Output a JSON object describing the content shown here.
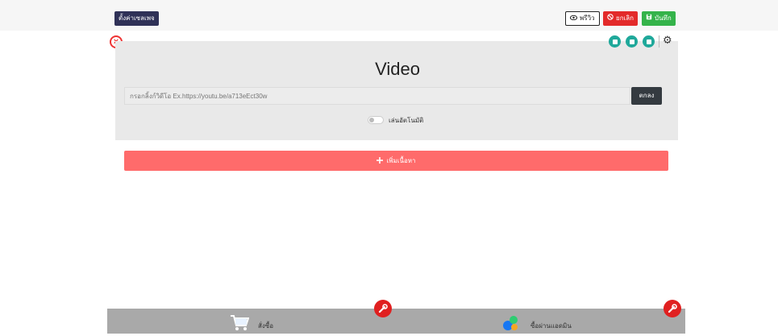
{
  "toolbar": {
    "settings_label": "ตั้งค่าเซลเพจ",
    "preview_label": "พรีวิว",
    "cancel_label": "ยกเลิก",
    "save_label": "บันทึก"
  },
  "video_block": {
    "title": "Video",
    "url_placeholder": "กรอกลิ้งก์วิดีโอ Ex.https://youtu.be/a713eEct30w",
    "ok_label": "ตกลง",
    "autoplay_label": "เล่นอัตโนมัติ"
  },
  "add_content_label": "เพิ่มเนื้อหา",
  "footer": {
    "order_label": "สั่งซื้อ",
    "admin_label": "ซื้อผ่านแอดมิน"
  },
  "colors": {
    "accent_teal": "#1fa89a",
    "danger": "#e32a2a",
    "success": "#34b34a",
    "add_button": "#ff6b6b",
    "dark": "#2f3157"
  }
}
